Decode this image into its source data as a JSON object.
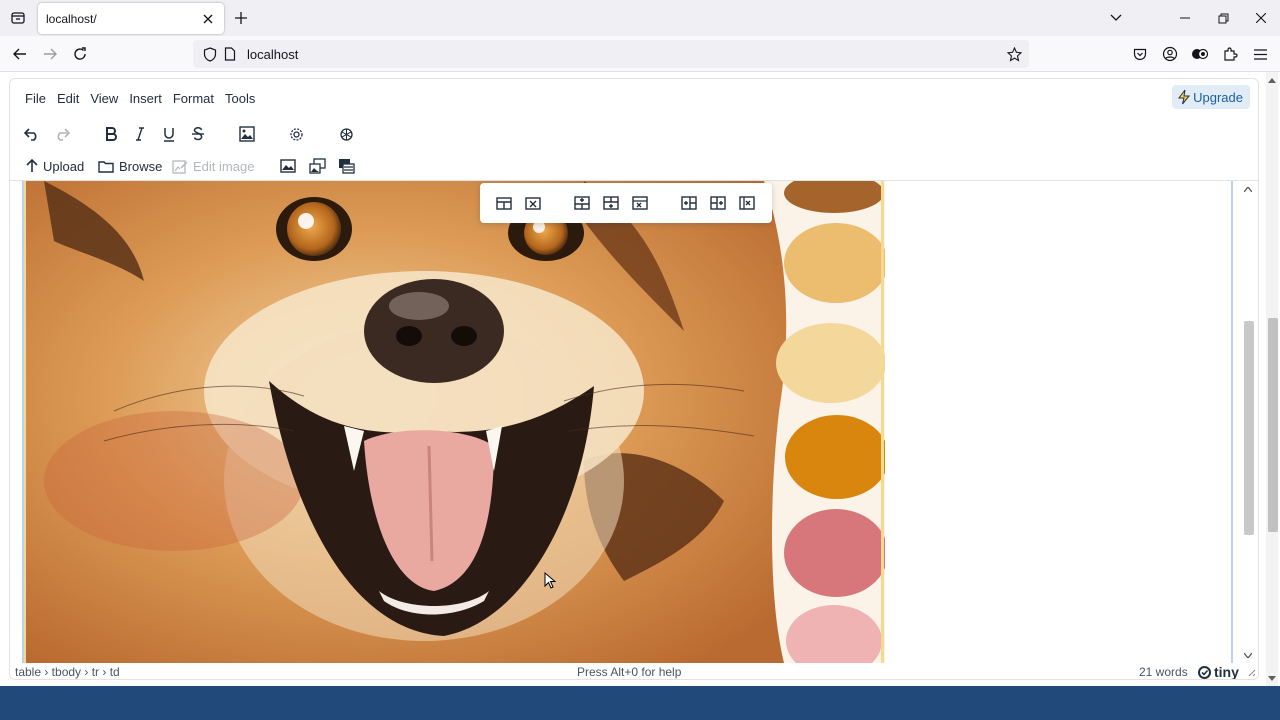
{
  "browser": {
    "tab_title": "localhost/",
    "url": "localhost"
  },
  "editor": {
    "menus": [
      "File",
      "Edit",
      "View",
      "Insert",
      "Format",
      "Tools"
    ],
    "upgrade_label": "Upgrade",
    "toolbar2": {
      "upload": "Upload",
      "browse": "Browse",
      "edit_image": "Edit image"
    },
    "status": {
      "path": "table › tbody › tr › td",
      "help": "Press Alt+0 for help",
      "words": "21 words",
      "brand": "tiny"
    }
  },
  "colors": {
    "footer": "#21497a",
    "upgrade_bg": "#e1ecf7",
    "table_border": "#b7d3ef",
    "swatches": [
      "#a5642b",
      "#ecbc6f",
      "#f4d79b",
      "#d9860f",
      "#d7777b",
      "#f0b3b3"
    ]
  },
  "image": {
    "subject": "watercolor dog portrait with paint swatches"
  }
}
